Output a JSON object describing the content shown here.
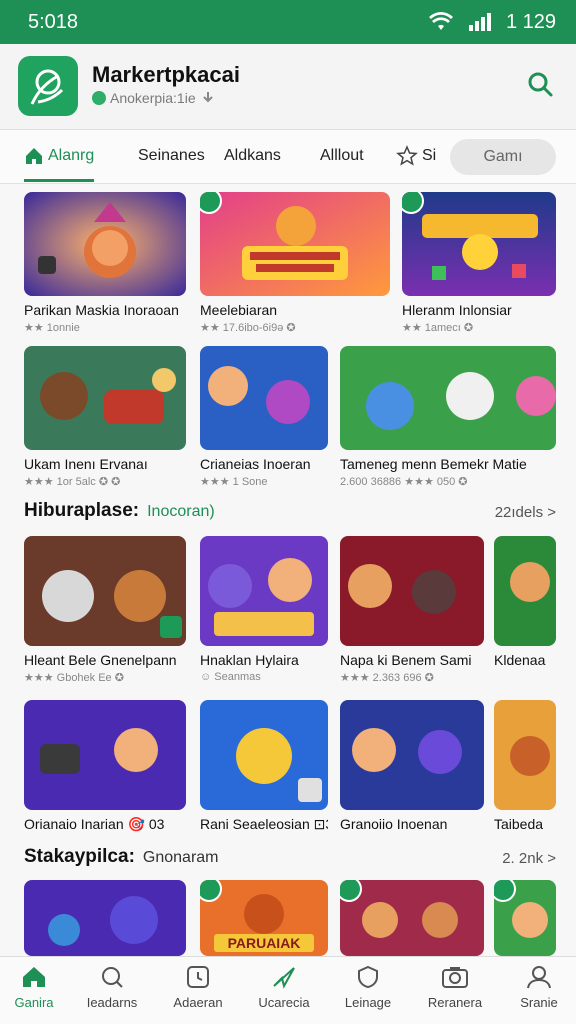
{
  "status": {
    "time": "5:018",
    "signal_time": "1 129"
  },
  "header": {
    "title": "Markertpkacai",
    "subtitle": "Anokerpia:1ie",
    "search_icon": "search-icon"
  },
  "tabs": [
    {
      "label": "Alanrg",
      "active": true
    },
    {
      "label": "Seinanes"
    },
    {
      "label": "Aldkans"
    },
    {
      "label": "Alllout"
    },
    {
      "label": "Si"
    }
  ],
  "games_button": "Gamı",
  "sections": [
    {
      "cards": [
        {
          "name": "Parikan Maskia Inoraoan",
          "meta": "★★ 1onnie"
        },
        {
          "name": "Meelebiaran",
          "meta": "★★ 17.6ibo-6i9ə ✪"
        },
        {
          "name": "Hleranm Inlonsiar",
          "meta": "★★ 1amecı ✪"
        },
        {
          "name": "Ukam Inenı Ervanaı",
          "meta": "★★★ 1or 5alc ✪ ✪"
        },
        {
          "name": "Crianeias Inoeran",
          "meta": "★★★ 1 Sone"
        },
        {
          "name": "Tameneg menn Bemekr Matie",
          "meta": "2.600 36886 ★★★ 050 ✪"
        }
      ]
    },
    {
      "title": "Hiburaplase:",
      "subtitle": "Inocoran)",
      "more": "22ıdels >",
      "cards": [
        {
          "name": "Hleant Bele Gnenelpann",
          "meta": "★★★ Gbohek Ee ✪"
        },
        {
          "name": "Hnaklan Hylaira",
          "meta": "☺ Seanmas"
        },
        {
          "name": "Napa ki Benem Sami",
          "meta": "★★★ 2.363 696 ✪"
        },
        {
          "name": "Kldenaa",
          "meta": ""
        },
        {
          "name": "Orianaio Inarian 🎯 03",
          "meta": ""
        },
        {
          "name": "Rani Seaeleosian ⊡3",
          "meta": ""
        },
        {
          "name": "Granoiio Inoenan",
          "meta": ""
        },
        {
          "name": "Taibeda",
          "meta": ""
        }
      ]
    },
    {
      "title": "Stakaypilca:",
      "subtitle": "Gnonaram",
      "more": "2. 2nk >",
      "cards": [
        {
          "name": ""
        },
        {
          "name": "PARUAIAK"
        },
        {
          "name": ""
        },
        {
          "name": ""
        }
      ]
    }
  ],
  "bottom_nav": [
    {
      "label": "Ganira",
      "icon": "home-icon",
      "active": true
    },
    {
      "label": "Ieadarns",
      "icon": "search-icon"
    },
    {
      "label": "Adaeran",
      "icon": "clock-icon"
    },
    {
      "label": "Ucarecia",
      "icon": "send-icon"
    },
    {
      "label": "Leinage",
      "icon": "shield-icon"
    },
    {
      "label": "Reranera",
      "icon": "camera-icon"
    },
    {
      "label": "Sranie",
      "icon": "user-icon"
    }
  ],
  "colors": {
    "brand": "#1e8f55",
    "status_bar": "#1e8f55"
  }
}
